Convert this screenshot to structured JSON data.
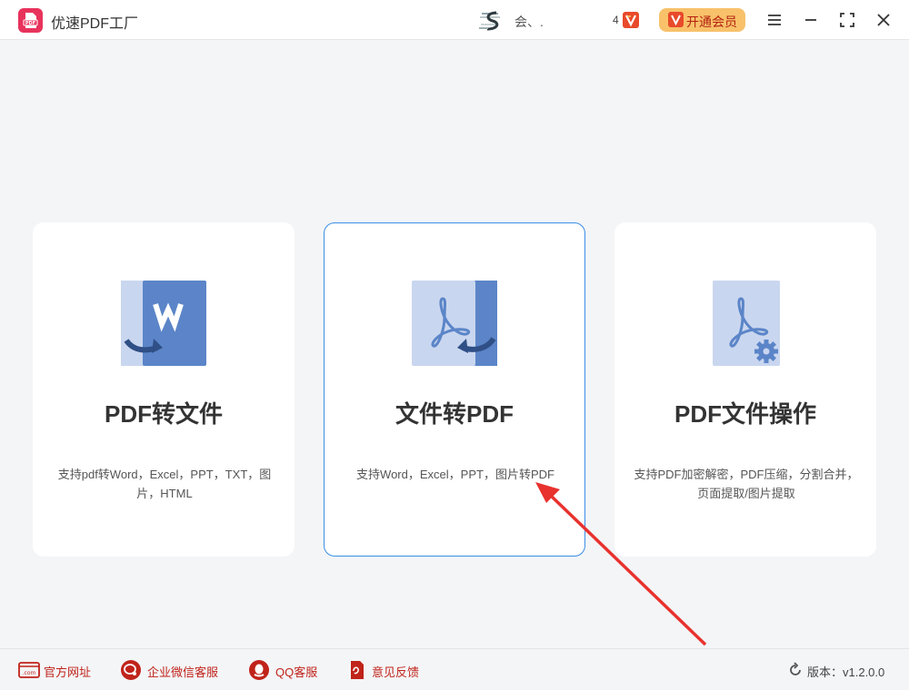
{
  "app": {
    "title": "优速PDF工厂",
    "logo_text": "PDF"
  },
  "header": {
    "user_name": "会、.",
    "vip_count": "4",
    "vip_button_label": "开通会员",
    "accent_color": "#f8c16a",
    "vip_text_color": "#b4210f"
  },
  "window_controls": [
    "menu-icon",
    "minimize-icon",
    "maximize-icon",
    "close-icon"
  ],
  "cards": [
    {
      "id": "pdf-to-file",
      "title": "PDF转文件",
      "description": "支持pdf转Word，Excel，PPT，TXT，图片，HTML",
      "icon": "word-convert-icon"
    },
    {
      "id": "file-to-pdf",
      "title": "文件转PDF",
      "description": "支持Word，Excel，PPT，图片转PDF",
      "icon": "pdf-convert-icon",
      "selected": true
    },
    {
      "id": "pdf-operations",
      "title": "PDF文件操作",
      "description": "支持PDF加密解密，PDF压缩，分割合并，页面提取/图片提取",
      "icon": "pdf-settings-icon"
    }
  ],
  "footer": {
    "links": [
      {
        "label": "官方网址",
        "icon": "website-icon"
      },
      {
        "label": "企业微信客服",
        "icon": "wechat-work-icon"
      },
      {
        "label": "QQ客服",
        "icon": "qq-icon"
      },
      {
        "label": "意见反馈",
        "icon": "feedback-icon"
      }
    ],
    "version_text": "版本：v1.2.0.0"
  },
  "colors": {
    "card_border_active": "#3a8ee6",
    "icon_blue": "#5b85c8",
    "arrow_red": "#e8322e"
  }
}
